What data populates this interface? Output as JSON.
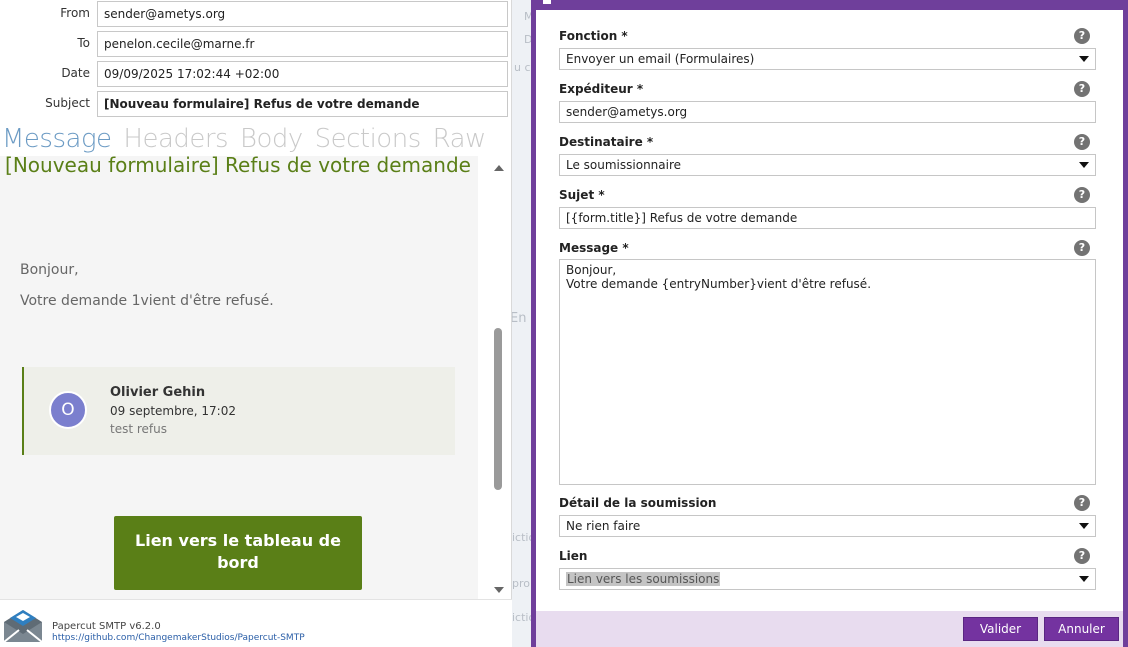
{
  "papercut": {
    "headers": {
      "from": {
        "label": "From",
        "value": "sender@ametys.org"
      },
      "to": {
        "label": "To",
        "value": "penelon.cecile@marne.fr"
      },
      "date": {
        "label": "Date",
        "value": "09/09/2025 17:02:44 +02:00"
      },
      "subject": {
        "label": "Subject",
        "value": "[Nouveau formulaire] Refus de votre demande"
      }
    },
    "tabs": [
      "Message",
      "Headers",
      "Body",
      "Sections",
      "Raw"
    ],
    "active_tab": "Message",
    "email": {
      "title": "[Nouveau formulaire] Refus de votre demande",
      "greeting": "Bonjour,",
      "line": "Votre demande 1vient d'être refusé.",
      "comment": {
        "avatar_initial": "O",
        "author": "Olivier Gehin",
        "date": "09 septembre, 17:02",
        "text": "test refus"
      },
      "cta_label": "Lien vers le tableau de bord"
    },
    "footer": {
      "version": "Papercut SMTP v6.2.0",
      "link": "https://github.com/ChangemakerStudios/Papercut-SMTP"
    }
  },
  "background_fragments": [
    "M",
    "D",
    "u cy",
    "En",
    "ictio",
    "pro",
    "ictio"
  ],
  "dialog": {
    "fields": {
      "fonction": {
        "label": "Fonction *",
        "value": "Envoyer un email (Formulaires)"
      },
      "expediteur": {
        "label": "Expéditeur *",
        "value": "sender@ametys.org"
      },
      "destinataire": {
        "label": "Destinataire *",
        "value": "Le soumissionnaire"
      },
      "sujet": {
        "label": "Sujet *",
        "value": "[{form.title}] Refus de votre demande"
      },
      "message": {
        "label": "Message *",
        "line1": "Bonjour,",
        "line2": "Votre demande {entryNumber}vient d'être refusé."
      },
      "detail": {
        "label": "Détail de la soumission",
        "value": "Ne rien faire"
      },
      "lien": {
        "label": "Lien",
        "value": "Lien vers les soumissions"
      }
    },
    "help_glyph": "?",
    "buttons": {
      "ok": "Valider",
      "cancel": "Annuler"
    },
    "colors": {
      "accent": "#7433a0",
      "frame": "#6f3f9b"
    }
  }
}
